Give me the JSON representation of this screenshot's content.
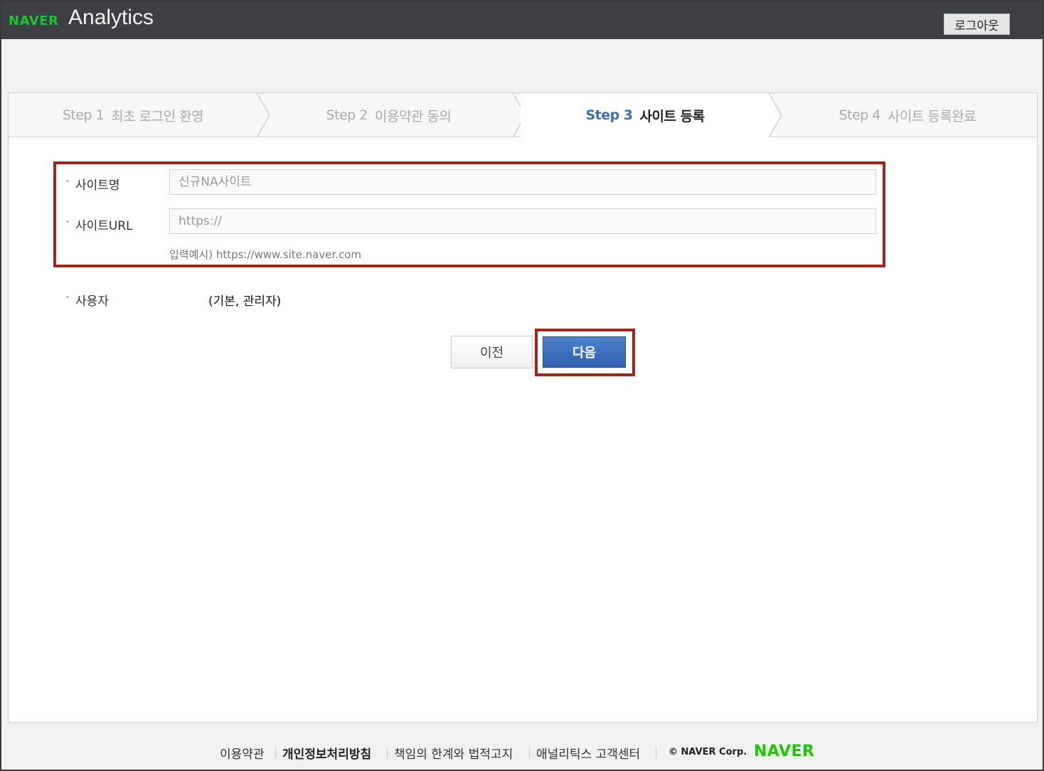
{
  "header": {
    "logo_brand": "NAVER",
    "logo_product": "Analytics",
    "logout_label": "로그아웃"
  },
  "steps": [
    {
      "num": "Step 1",
      "label": "최초 로그인 환영",
      "active": false
    },
    {
      "num": "Step 2",
      "label": "이용약관 동의",
      "active": false
    },
    {
      "num": "Step 3",
      "label": "사이트 등록",
      "active": true
    },
    {
      "num": "Step 4",
      "label": "사이트 등록완료",
      "active": false
    }
  ],
  "form": {
    "site_name_label": "사이트명",
    "site_name_placeholder": "신규NA사이트",
    "site_url_label": "사이트URL",
    "site_url_placeholder": "https://",
    "site_url_hint": "입력예시) https://www.site.naver.com",
    "user_label": "사용자",
    "user_value": "(기본, 관리자)"
  },
  "buttons": {
    "prev_label": "이전",
    "next_label": "다음"
  },
  "footer": {
    "links": [
      "이용약관",
      "개인정보처리방침",
      "책임의 한계와 법적고지",
      "애널리틱스 고객센터"
    ],
    "copyright": "© NAVER Corp.",
    "brand": "NAVER"
  },
  "colors": {
    "header_bg": "#3d3f42",
    "brand_green": "#1ec800",
    "accent_blue": "#3b6fb6",
    "highlight_red": "#a7211d"
  }
}
